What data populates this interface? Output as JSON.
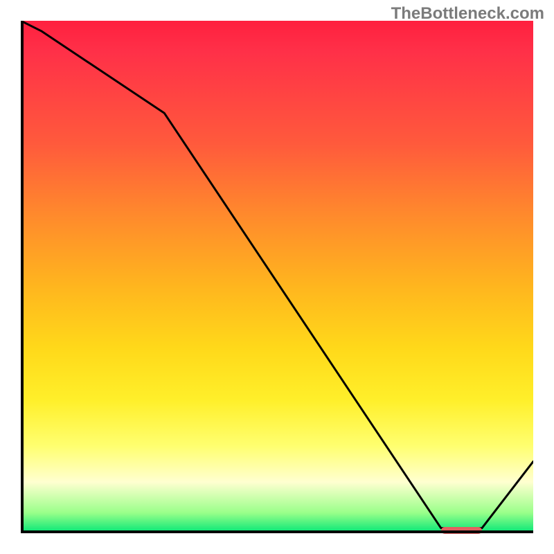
{
  "watermark": "TheBottleneck.com",
  "chart_data": {
    "type": "line",
    "title": "",
    "xlabel": "",
    "ylabel": "",
    "xlim": [
      0,
      100
    ],
    "ylim": [
      0,
      100
    ],
    "x": [
      0,
      4,
      28,
      82,
      90,
      100
    ],
    "values": [
      100,
      98,
      82,
      1,
      1,
      14
    ],
    "marker": {
      "x_start": 82,
      "x_end": 90,
      "y": 0.6
    },
    "gradient_stops": [
      {
        "pos": 0,
        "color": "#ff203f"
      },
      {
        "pos": 24,
        "color": "#ff5a3c"
      },
      {
        "pos": 52,
        "color": "#ffb61e"
      },
      {
        "pos": 74,
        "color": "#ffef2a"
      },
      {
        "pos": 90,
        "color": "#ffffd0"
      },
      {
        "pos": 100,
        "color": "#00e676"
      }
    ]
  }
}
